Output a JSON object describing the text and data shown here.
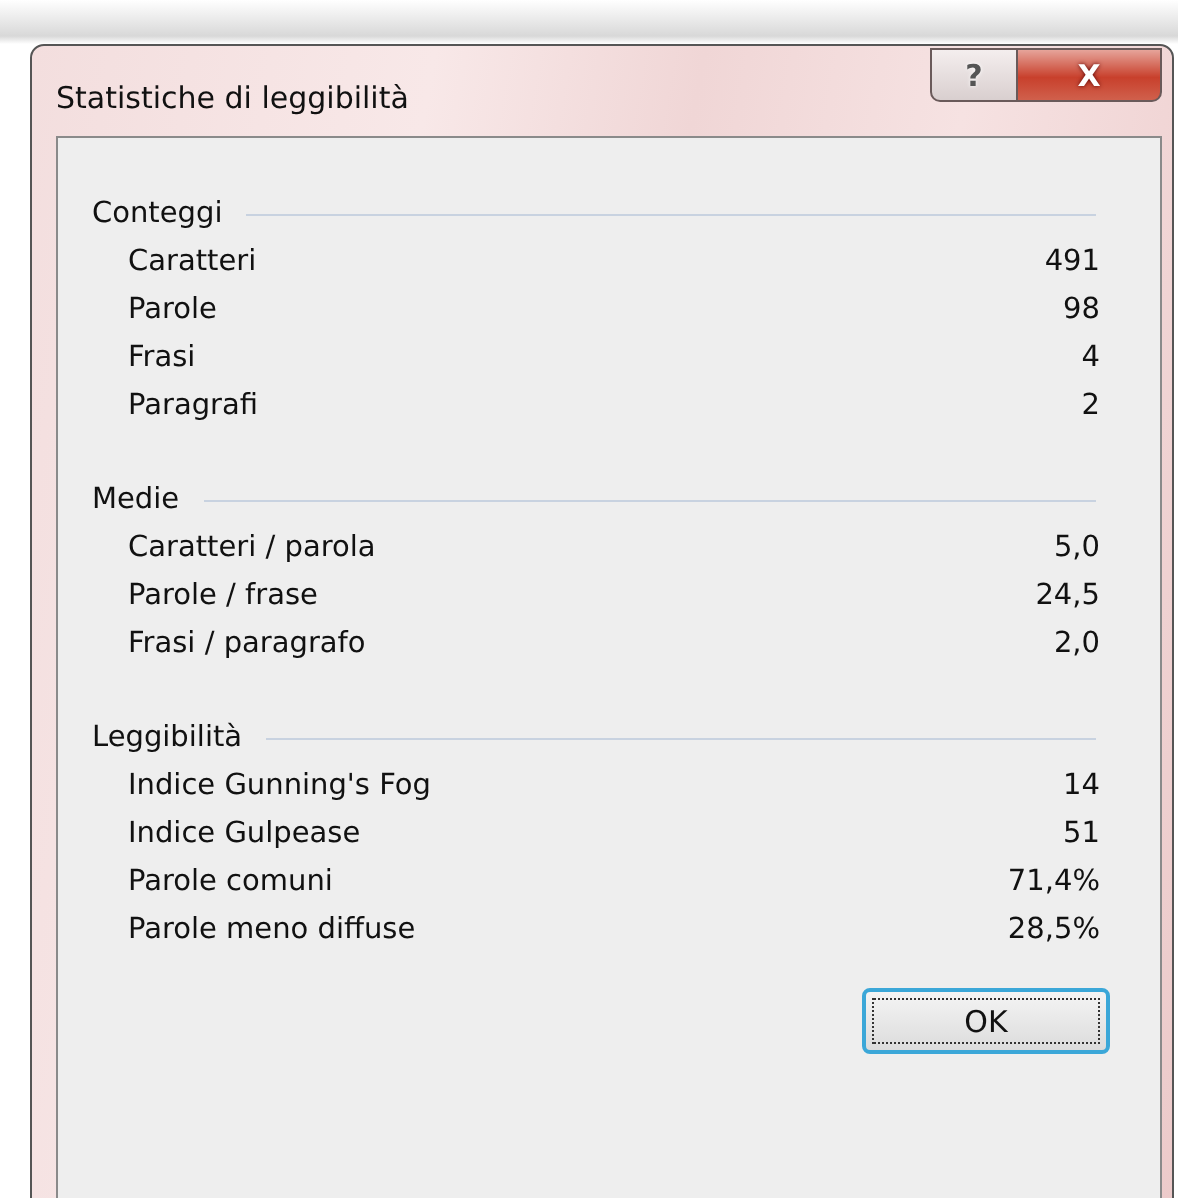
{
  "window": {
    "title": "Statistiche di leggibilità",
    "title_buttons": [
      "?",
      "X"
    ]
  },
  "sections": [
    {
      "title": "Conteggi",
      "rows": [
        {
          "label": "Caratteri",
          "value": "491"
        },
        {
          "label": "Parole",
          "value": "98"
        },
        {
          "label": "Frasi",
          "value": "4"
        },
        {
          "label": "Paragrafi",
          "value": "2"
        }
      ]
    },
    {
      "title": "Medie",
      "rows": [
        {
          "label": "Caratteri / parola",
          "value": "5,0"
        },
        {
          "label": "Parole / frase",
          "value": "24,5"
        },
        {
          "label": "Frasi / paragrafo",
          "value": "2,0"
        }
      ]
    },
    {
      "title": "Leggibilità",
      "rows": [
        {
          "label": "Indice Gunning's Fog",
          "value": "14"
        },
        {
          "label": "Indice Gulpease",
          "value": "51"
        },
        {
          "label": "Parole comuni",
          "value": "71,4%"
        },
        {
          "label": "Parole meno diffuse",
          "value": "28,5%"
        }
      ]
    }
  ],
  "buttons": [
    "OK"
  ]
}
